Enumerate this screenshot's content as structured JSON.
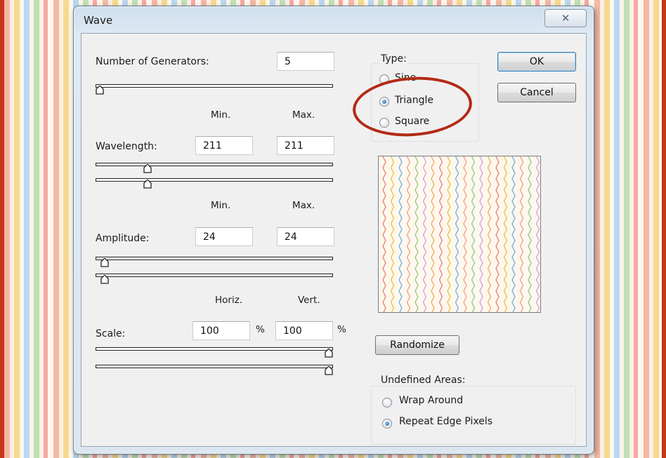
{
  "dialog": {
    "title": "Wave",
    "close_symbol": "✕"
  },
  "generators": {
    "label": "Number of Generators:",
    "value": "5",
    "slider_level": 0.0
  },
  "wavelength": {
    "min_header": "Min.",
    "max_header": "Max.",
    "label": "Wavelength:",
    "min_value": "211",
    "max_value": "211",
    "min_slider_level": 0.21,
    "max_slider_level": 0.21
  },
  "amplitude": {
    "min_header": "Min.",
    "max_header": "Max.",
    "label": "Amplitude:",
    "min_value": "24",
    "max_value": "24",
    "min_slider_level": 0.02,
    "max_slider_level": 0.02
  },
  "scale": {
    "horiz_header": "Horiz.",
    "vert_header": "Vert.",
    "label": "Scale:",
    "horiz_value": "100",
    "vert_value": "100",
    "unit": "%",
    "horiz_slider_level": 1.0,
    "vert_slider_level": 1.0
  },
  "type": {
    "group_label": "Type:",
    "options": [
      {
        "label": "Sine",
        "checked": false
      },
      {
        "label": "Triangle",
        "checked": true
      },
      {
        "label": "Square",
        "checked": false
      }
    ]
  },
  "buttons": {
    "ok": "OK",
    "cancel": "Cancel",
    "randomize": "Randomize"
  },
  "undefined_areas": {
    "group_label": "Undefined Areas:",
    "options": [
      {
        "label": "Wrap Around",
        "checked": false
      },
      {
        "label": "Repeat Edge Pixels",
        "checked": true
      }
    ]
  },
  "colors": {
    "annotation_circle": "#b22a14",
    "frame": "#c8361c"
  }
}
